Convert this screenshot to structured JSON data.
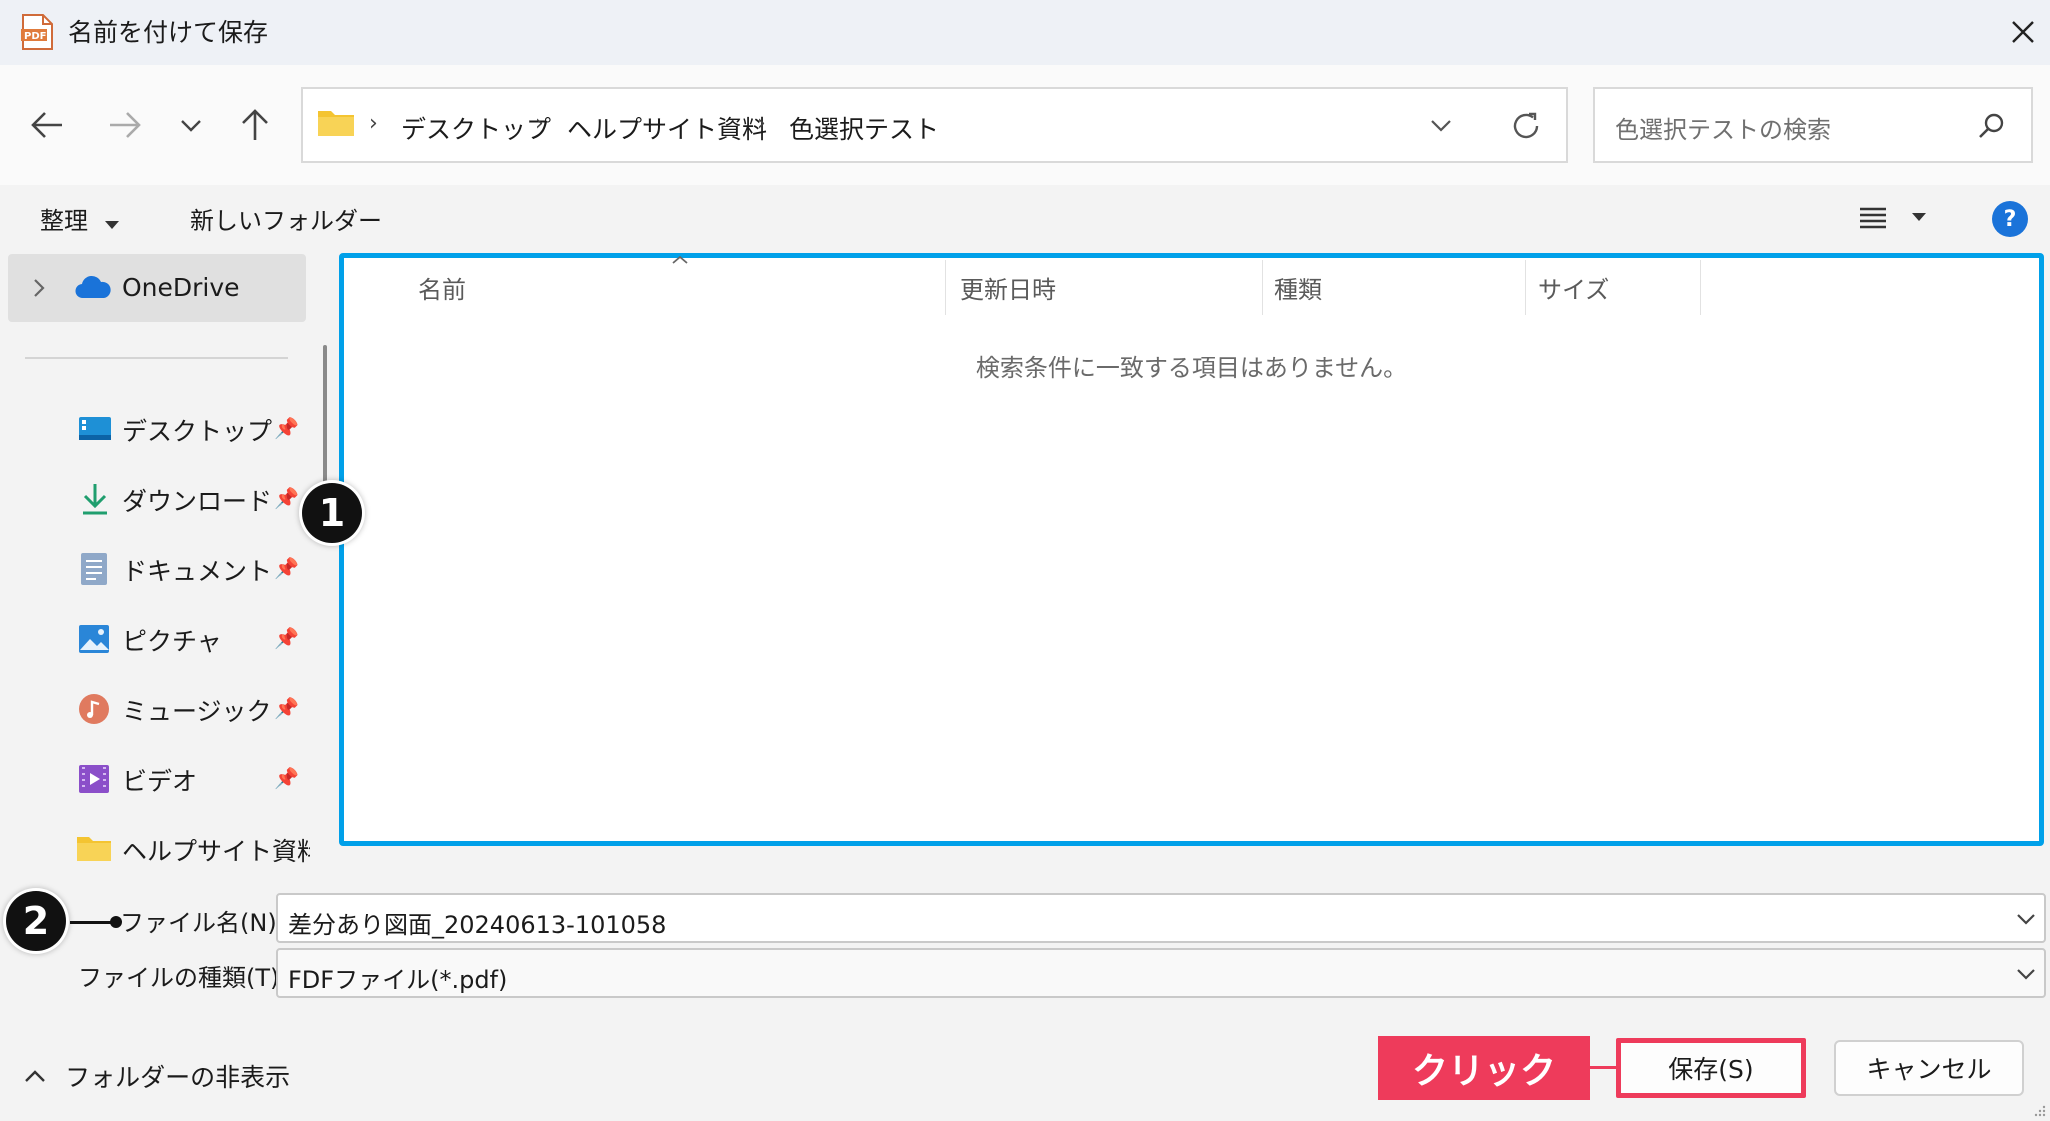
{
  "titlebar": {
    "title": "名前を付けて保存",
    "app_icon": "pdf-icon",
    "close_icon": "close-icon"
  },
  "address": {
    "folder_icon": "folder-icon",
    "crumbs": [
      "デスクトップ",
      "ヘルプサイト資料",
      "色選択テスト"
    ],
    "separator": "›"
  },
  "search": {
    "placeholder": "色選択テストの検索",
    "icon": "search-icon"
  },
  "commandbar": {
    "organize_label": "整理",
    "new_folder_label": "新しいフォルダー",
    "view_icon": "list-view-icon",
    "help_label": "?"
  },
  "navpane": {
    "onedrive_label": "OneDrive",
    "items": [
      {
        "label": "デスクトップ",
        "icon": "desktop-icon"
      },
      {
        "label": "ダウンロード",
        "icon": "download-icon"
      },
      {
        "label": "ドキュメント",
        "icon": "document-icon"
      },
      {
        "label": "ピクチャ",
        "icon": "pictures-icon"
      },
      {
        "label": "ミュージック",
        "icon": "music-icon"
      },
      {
        "label": "ビデオ",
        "icon": "video-icon"
      },
      {
        "label": "ヘルプサイト資料",
        "icon": "folder-icon"
      }
    ]
  },
  "filelist": {
    "columns": [
      "名前",
      "更新日時",
      "種類",
      "サイズ"
    ],
    "empty_message": "検索条件に一致する項目はありません。"
  },
  "form": {
    "filename_label": "ファイル名(N):",
    "filename_value": "差分あり図面_20240613-101058",
    "filetype_label": "ファイルの種類(T):",
    "filetype_value": "FDFファイル(*.pdf)"
  },
  "footer": {
    "hide_folders_label": "フォルダーの非表示",
    "save_label": "保存(S)",
    "cancel_label": "キャンセル"
  },
  "annotations": {
    "badge1": "1",
    "badge2": "2",
    "click_label": "クリック"
  },
  "colors": {
    "highlight_blue": "#00a0e9",
    "annotation_red": "#ee3b5b",
    "folder_yellow": "#f4c431"
  }
}
